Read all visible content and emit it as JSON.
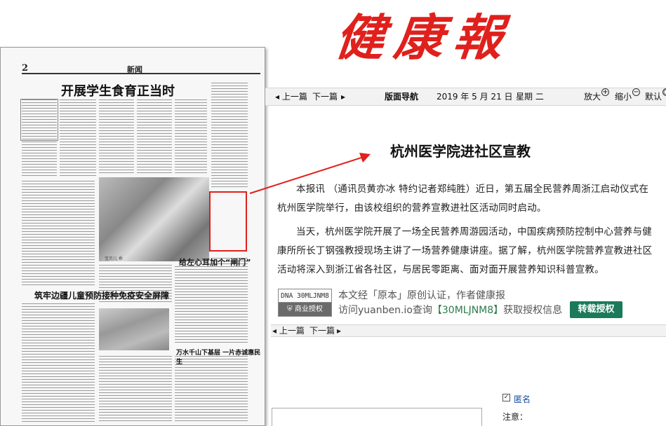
{
  "masthead": {
    "title": "健康報"
  },
  "paper": {
    "page_no": "2",
    "page_name": "新闻",
    "headline_main": "开展学生食育正当时",
    "headline_secondary": "筑牢边疆儿童预防接种免疫安全屏障",
    "headline_side": "给左心耳加个“闸门”",
    "headline_bottom": "万水千山下基层 一片赤诚惠民生",
    "photo_caption": "宝贝儿 乖"
  },
  "nav": {
    "prev": "上一篇",
    "next": "下一篇",
    "guide": "版面导航",
    "date": "2019 年 5 月 21 日",
    "weekday": "星期 二",
    "zoom_in": "放大",
    "zoom_out": "缩小",
    "default": "默认"
  },
  "article": {
    "title": "杭州医学院进社区宣教",
    "paragraphs": [
      "本报讯 （通讯员黄亦冰 特约记者郑纯胜）近日，第五届全民营养周浙江启动仪式在杭州医学院举行，由该校组织的营养宣教进社区活动同时启动。",
      "当天，杭州医学院开展了一场全民营养周游园活动，中国疾病预防控制中心营养与健康所所长丁钢强教授现场主讲了一场营养健康讲座。据了解，杭州医学院营养宣教进社区活动将深入到浙江省各社区，与居民零距离、面对面开展营养知识科普宣教。"
    ]
  },
  "copyright": {
    "dna_code": "DNA 30MLJNM8",
    "badge": "商业授权",
    "line1": "本文经「原本」原创认证，作者健康报",
    "line2_prefix": "访问yuanben.io查询",
    "line2_code": "【30MLJNM8】",
    "line2_suffix": "获取授权信息",
    "reprint_button": "转载授权"
  },
  "nav_bottom": {
    "prev": "上一篇",
    "next": "下一篇"
  },
  "comment": {
    "anonymous_label": "匿名",
    "notice_label": "注意："
  }
}
